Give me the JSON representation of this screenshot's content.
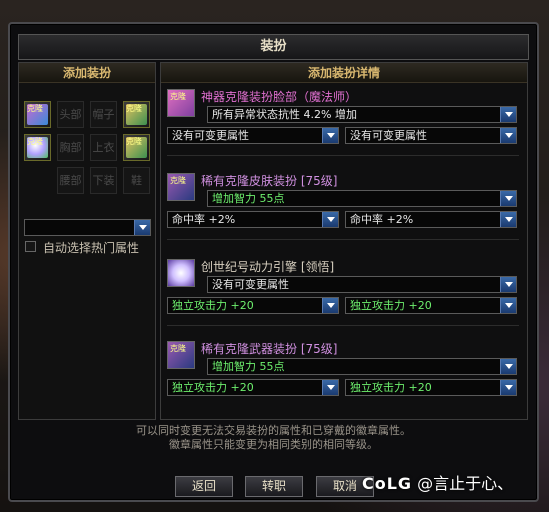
{
  "window": {
    "title": "装扮"
  },
  "left": {
    "title": "添加装扮",
    "slots": [
      "头部",
      "帽子",
      "胸部",
      "上衣",
      "腰部",
      "下装",
      "鞋"
    ],
    "item_tags": [
      "克隆",
      "克隆",
      "克隆",
      "克隆"
    ],
    "dropdown_value": "",
    "auto_select_label": "自动选择热门属性"
  },
  "right": {
    "title": "添加装扮详情",
    "groups": [
      {
        "name": "神器克隆装扮脸部（魔法师）",
        "tag": "克隆",
        "main": "所有异常状态抗性 4.2% 增加",
        "sub1": "没有可变更属性",
        "sub2": "没有可变更属性"
      },
      {
        "name": "稀有克隆皮肤装扮 [75级]",
        "tag": "克隆",
        "main": "增加智力 55点",
        "sub1": "命中率 +2%",
        "sub2": "命中率 +2%"
      },
      {
        "name": "创世纪号动力引擎 [领悟]",
        "main": "没有可变更属性",
        "sub1": "独立攻击力 +20",
        "sub2": "独立攻击力 +20"
      },
      {
        "name": "稀有克隆武器装扮 [75级]",
        "tag": "克隆",
        "main": "增加智力 55点",
        "sub1": "独立攻击力 +20",
        "sub2": "独立攻击力 +20"
      }
    ]
  },
  "notice": {
    "line1": "可以同时变更无法交易装扮的属性和已穿戴的徽章属性。",
    "line2": "徽章属性只能变更为相同类别的相同等级。"
  },
  "buttons": {
    "back": "返回",
    "transfer": "转职",
    "cancel": "取消"
  },
  "watermark": {
    "logo": "CoLG",
    "text": "@言止于心、"
  },
  "colors": {
    "accent_gold": "#d9b870",
    "green_text": "#6ef06e",
    "pink_text": "#e070d0"
  }
}
